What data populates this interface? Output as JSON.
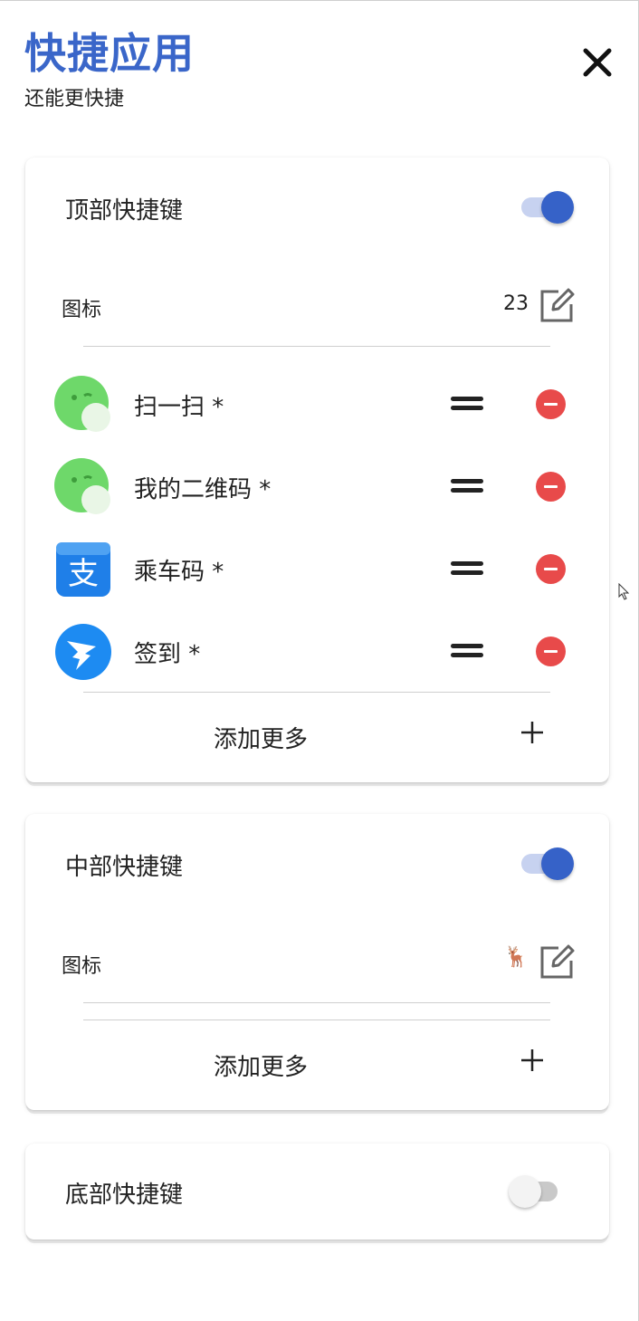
{
  "header": {
    "title": "快捷应用",
    "subtitle": "还能更快捷",
    "close_icon": "close-icon"
  },
  "sections": {
    "top": {
      "title": "顶部快捷键",
      "enabled": true,
      "icon_label": "图标",
      "icon_value": "23",
      "edit_icon": "edit-icon",
      "items": [
        {
          "name": "扫一扫 *",
          "icon": "wechat-icon"
        },
        {
          "name": "我的二维码 *",
          "icon": "wechat-icon"
        },
        {
          "name": "乘车码 *",
          "icon": "alipay-icon"
        },
        {
          "name": "签到 *",
          "icon": "dingtalk-icon"
        }
      ],
      "add_more": "添加更多"
    },
    "middle": {
      "title": "中部快捷键",
      "enabled": true,
      "icon_label": "图标",
      "icon_value": "🦌",
      "edit_icon": "edit-icon",
      "items": [],
      "add_more": "添加更多"
    },
    "bottom": {
      "title": "底部快捷键",
      "enabled": false
    }
  },
  "colors": {
    "accent": "#3662c8",
    "title": "#3a66c9",
    "remove": "#e84a4a",
    "wechat": "#5bd35b",
    "alipay": "#1f7fe8",
    "dingtalk": "#1d8bf2"
  }
}
